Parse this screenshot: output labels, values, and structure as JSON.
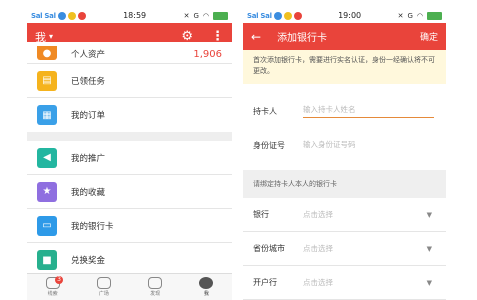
{
  "left": {
    "status": {
      "carrier": "Sal Sal",
      "time": "18:59",
      "network": "G"
    },
    "appbar": {
      "title": "我",
      "dropdown": "▾"
    },
    "rows": [
      {
        "label": "个人资产",
        "value": "1,906",
        "icon": "coin-icon",
        "color": "#f08a24"
      },
      {
        "label": "已领任务",
        "icon": "task-icon",
        "color": "#f5b31d"
      },
      {
        "label": "我的订单",
        "icon": "basket-icon",
        "color": "#3aa0e8"
      },
      {
        "label": "我的推广",
        "icon": "megaphone-icon",
        "color": "#23b6a0"
      },
      {
        "label": "我的收藏",
        "icon": "star-icon",
        "color": "#8f6fe0"
      },
      {
        "label": "我的银行卡",
        "icon": "card-icon",
        "color": "#2e9ae8"
      },
      {
        "label": "兑换奖金",
        "icon": "gift-icon",
        "color": "#27b08e"
      }
    ],
    "tabs": [
      {
        "label": "线索",
        "badge": "3"
      },
      {
        "label": "广场"
      },
      {
        "label": "发现"
      },
      {
        "label": "我"
      }
    ]
  },
  "right": {
    "status": {
      "carrier": "Sal Sal",
      "time": "19:00",
      "network": "G"
    },
    "appbar": {
      "back": "←",
      "title": "添加银行卡",
      "confirm": "确定"
    },
    "notice": "首次添加银行卡，需要进行实名认证，身份一经确认将不可更改。",
    "holder": {
      "label": "持卡人",
      "placeholder": "输入持卡人姓名"
    },
    "idno": {
      "label": "身份证号",
      "placeholder": "输入身份证号码"
    },
    "subhead": "请绑定持卡人本人的银行卡",
    "selects": [
      {
        "label": "银行",
        "value": "点击选择"
      },
      {
        "label": "省份城市",
        "value": "点击选择"
      },
      {
        "label": "开户行",
        "value": "点击选择"
      }
    ]
  }
}
